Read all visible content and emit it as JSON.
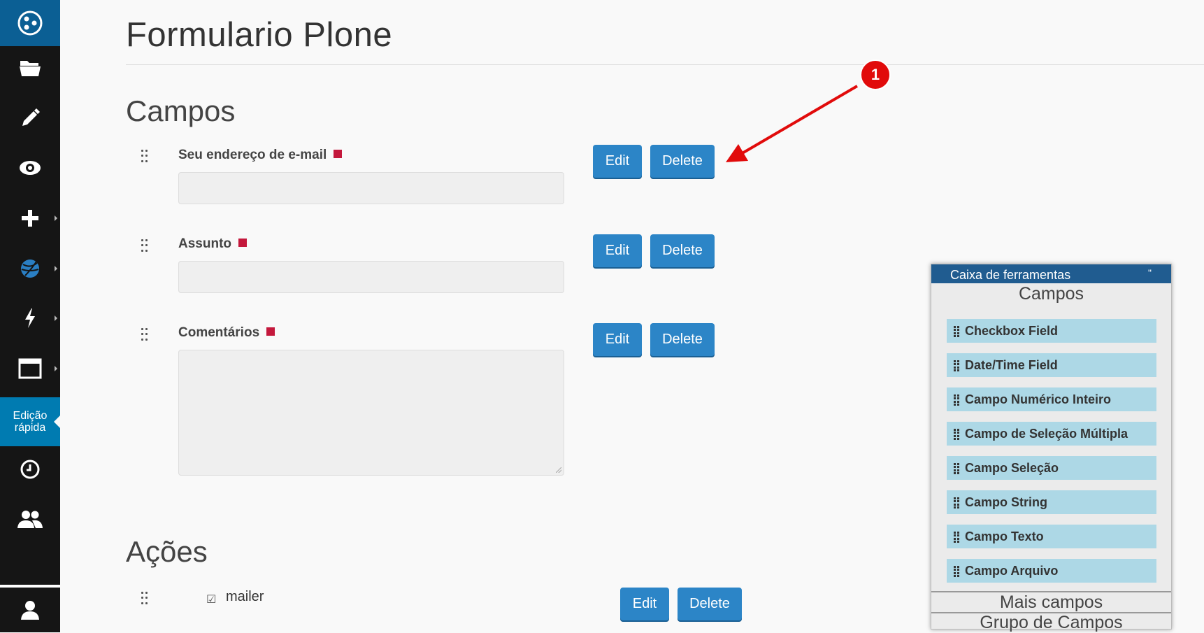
{
  "page": {
    "title": "Formulario Plone"
  },
  "toolbar": {
    "items": [
      {
        "name": "contents",
        "icon": "folder-icon"
      },
      {
        "name": "edit",
        "icon": "pencil-icon"
      },
      {
        "name": "view",
        "icon": "eye-icon"
      },
      {
        "name": "add",
        "icon": "plus-icon"
      },
      {
        "name": "state",
        "icon": "globe-icon"
      },
      {
        "name": "actions",
        "icon": "lightning-icon"
      },
      {
        "name": "display",
        "icon": "window-icon"
      },
      {
        "name": "history",
        "icon": "clock-icon"
      },
      {
        "name": "sharing",
        "icon": "users-icon"
      },
      {
        "name": "user",
        "icon": "user-icon"
      }
    ],
    "quick_edit_line1": "Edição",
    "quick_edit_line2": "rápida"
  },
  "fields_section": {
    "title": "Campos",
    "fields": [
      {
        "label": "Seu endereço de e-mail",
        "required": true,
        "type": "string",
        "edit_label": "Edit",
        "delete_label": "Delete"
      },
      {
        "label": "Assunto",
        "required": true,
        "type": "string",
        "edit_label": "Edit",
        "delete_label": "Delete"
      },
      {
        "label": "Comentários",
        "required": true,
        "type": "text",
        "edit_label": "Edit",
        "delete_label": "Delete"
      }
    ]
  },
  "actions_section": {
    "title": "Ações",
    "actions": [
      {
        "label": "mailer",
        "checkbox": "☑",
        "edit_label": "Edit",
        "delete_label": "Delete"
      }
    ]
  },
  "annotation": {
    "number": "1"
  },
  "toolbox": {
    "header": "Caixa de ferramentas",
    "close_mark": "\"",
    "sections": {
      "campos": "Campos",
      "mais_campos": "Mais campos",
      "grupo_campos": "Grupo de Campos"
    },
    "items": [
      "Checkbox Field",
      "Date/Time Field",
      "Campo Numérico Inteiro",
      "Campo de Seleção Múltipla",
      "Campo Seleção",
      "Campo String",
      "Campo Texto",
      "Campo Arquivo"
    ]
  },
  "colors": {
    "toolbar_bg": "#151515",
    "logo_bg": "#0b5f94",
    "quick_edit_bg": "#007bb1",
    "button_bg": "#2c85c7",
    "required_marker": "#c4183c",
    "annotation_red": "#e10b0b",
    "toolbox_header": "#205c90",
    "toolbox_item": "#add8e6"
  }
}
